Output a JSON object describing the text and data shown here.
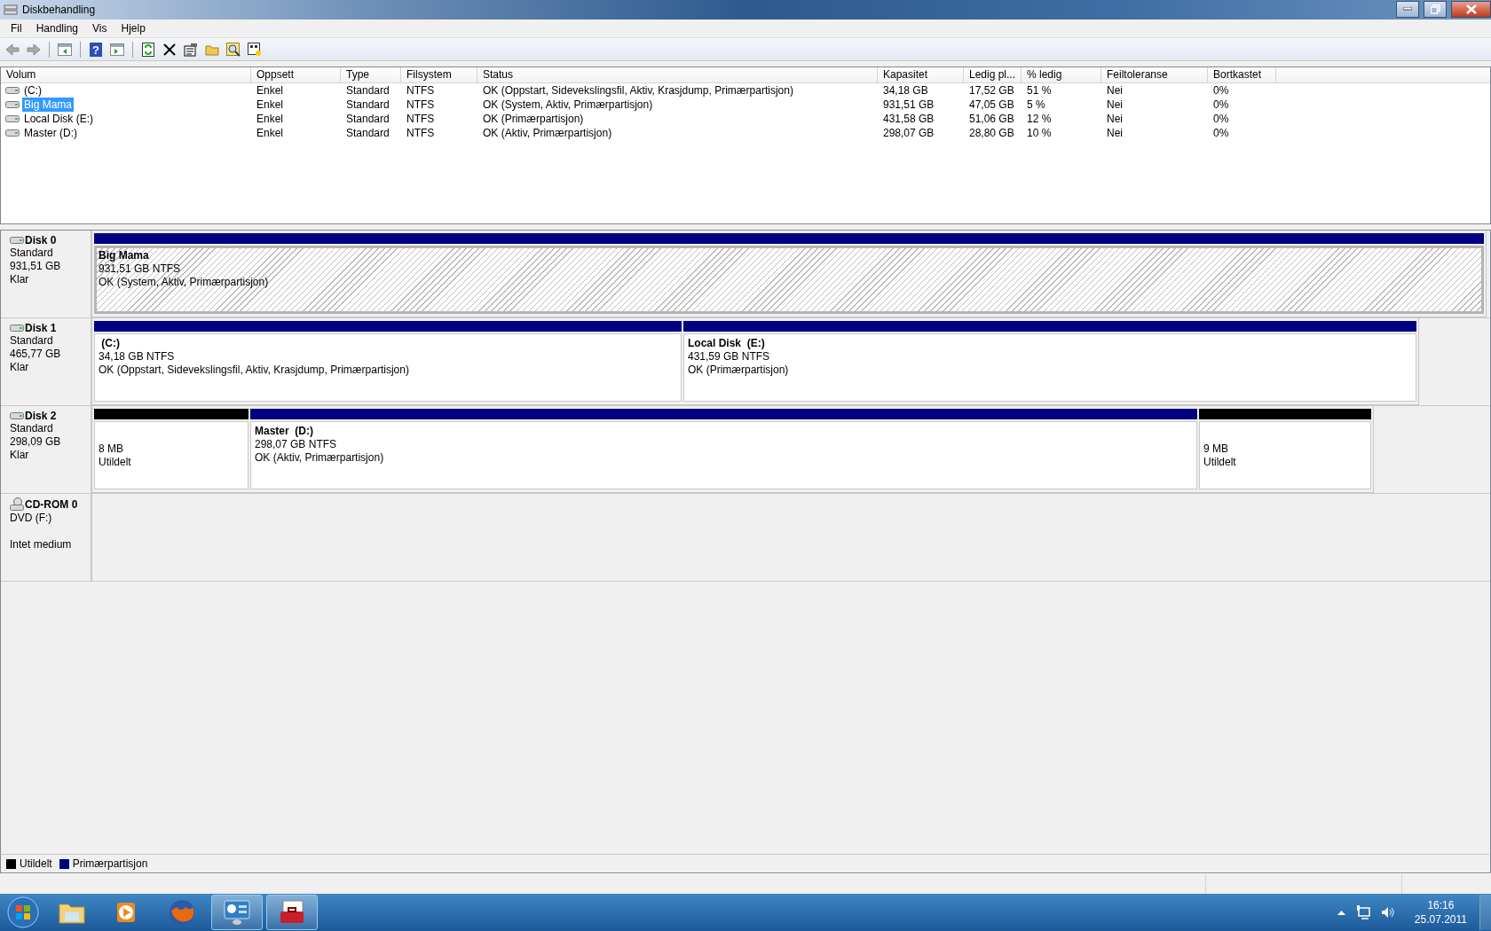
{
  "window": {
    "title": "Diskbehandling"
  },
  "menu": [
    "Fil",
    "Handling",
    "Vis",
    "Hjelp"
  ],
  "toolbar": {
    "help_glyph": "?"
  },
  "volume_table": {
    "columns": [
      "Volum",
      "Oppsett",
      "Type",
      "Filsystem",
      "Status",
      "Kapasitet",
      "Ledig pl...",
      "% ledig",
      "Feiltoleranse",
      "Bortkastet"
    ],
    "rows": [
      {
        "selected": false,
        "cells": [
          " (C:)",
          "Enkel",
          "Standard",
          "NTFS",
          "OK (Oppstart, Sidevekslingsfil, Aktiv, Krasjdump, Primærpartisjon)",
          "34,18 GB",
          "17,52 GB",
          "51 %",
          "Nei",
          "0%"
        ]
      },
      {
        "selected": true,
        "cells": [
          "Big Mama",
          "Enkel",
          "Standard",
          "NTFS",
          "OK (System, Aktiv, Primærpartisjon)",
          "931,51 GB",
          "47,05 GB",
          "5 %",
          "Nei",
          "0%"
        ]
      },
      {
        "selected": false,
        "cells": [
          "Local Disk (E:)",
          "Enkel",
          "Standard",
          "NTFS",
          "OK (Primærpartisjon)",
          "431,58 GB",
          "51,06 GB",
          "12 %",
          "Nei",
          "0%"
        ]
      },
      {
        "selected": false,
        "cells": [
          "Master (D:)",
          "Enkel",
          "Standard",
          "NTFS",
          "OK (Aktiv, Primærpartisjon)",
          "298,07 GB",
          "28,80 GB",
          "10 %",
          "Nei",
          "0%"
        ]
      }
    ]
  },
  "disks": [
    {
      "kind": "disk",
      "name": "Disk 0",
      "lines": [
        "Standard",
        "931,51 GB",
        "Klar"
      ],
      "partitions": [
        {
          "kind": "primary",
          "selected": true,
          "name": "Big Mama",
          "size": "931,51 GB NTFS",
          "status": "OK (System, Aktiv, Primærpartisjon)"
        }
      ]
    },
    {
      "kind": "disk",
      "name": "Disk 1",
      "lines": [
        "Standard",
        "465,77 GB",
        "Klar"
      ],
      "partitions": [
        {
          "kind": "primary",
          "selected": false,
          "name": " (C:)",
          "size": "34,18 GB NTFS",
          "status": "OK (Oppstart, Sidevekslingsfil, Aktiv, Krasjdump, Primærpartisjon)"
        },
        {
          "kind": "primary",
          "selected": false,
          "name": "Local Disk  (E:)",
          "size": "431,59 GB NTFS",
          "status": "OK (Primærpartisjon)"
        }
      ]
    },
    {
      "kind": "disk",
      "name": "Disk 2",
      "lines": [
        "Standard",
        "298,09 GB",
        "Klar"
      ],
      "partitions": [
        {
          "kind": "unallocated",
          "selected": false,
          "size": "8 MB",
          "status": "Utildelt"
        },
        {
          "kind": "primary",
          "selected": false,
          "name": "Master  (D:)",
          "size": "298,07 GB NTFS",
          "status": "OK (Aktiv, Primærpartisjon)"
        },
        {
          "kind": "unallocated",
          "selected": false,
          "size": "9 MB",
          "status": "Utildelt"
        }
      ]
    },
    {
      "kind": "cdrom",
      "name": "CD-ROM 0",
      "lines": [
        "DVD (F:)",
        "Intet medium"
      ]
    }
  ],
  "legend": [
    {
      "label": "Utildelt",
      "color": "#000000"
    },
    {
      "label": "Primærpartisjon",
      "color": "#000080"
    }
  ],
  "taskbar": {
    "apps": [
      {
        "kind": "folder",
        "running": false
      },
      {
        "kind": "media",
        "running": false
      },
      {
        "kind": "browser",
        "running": false
      },
      {
        "kind": "panel",
        "running": true
      },
      {
        "kind": "toolbox",
        "running": true
      }
    ],
    "clock": {
      "time": "16:16",
      "date": "25.07.2011"
    }
  }
}
